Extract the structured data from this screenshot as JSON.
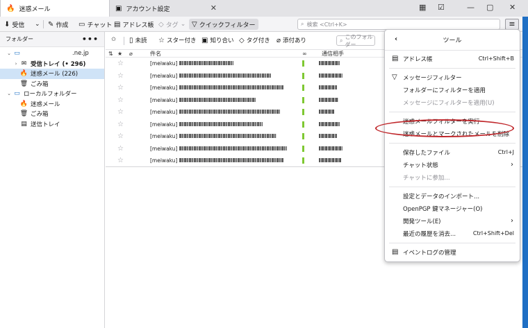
{
  "tabs": [
    {
      "label": "迷惑メール"
    },
    {
      "label": "アカウント設定"
    }
  ],
  "toolbar": {
    "get_messages": "受信",
    "compose": "作成",
    "chat": "チャット",
    "address_book": "アドレス帳",
    "tag": "タグ",
    "quick_filter": "クイックフィルター",
    "search_placeholder": "検索 <Ctrl+K>"
  },
  "folder_pane": {
    "header": "フォルダー",
    "account": ".ne.jp",
    "folders": [
      {
        "label": "受信トレイ (• 296)",
        "icon": "envelope-icon"
      },
      {
        "label": "迷惑メール (226)",
        "icon": "junk-icon",
        "selected": true
      },
      {
        "label": "ごみ箱",
        "icon": "trash-icon"
      }
    ],
    "local_label": "ローカルフォルダー",
    "local_folders": [
      {
        "label": "迷惑メール",
        "icon": "junk-icon"
      },
      {
        "label": "ごみ箱",
        "icon": "trash-icon"
      },
      {
        "label": "送信トレイ",
        "icon": "outbox-icon"
      }
    ]
  },
  "quick_filter_bar": {
    "unread": "未読",
    "starred": "スター付き",
    "contacts": "知り合い",
    "tagged": "タグ付き",
    "attachments": "添付あり",
    "filter_placeholder": "このフォルダー"
  },
  "columns": {
    "subject": "件名",
    "correspondent": "通信相手"
  },
  "messages": [
    {
      "sender": "[meiwaku]"
    },
    {
      "sender": "[meiwaku]"
    },
    {
      "sender": "[meiwaku]"
    },
    {
      "sender": "[meiwaku]"
    },
    {
      "sender": "[meiwaku]"
    },
    {
      "sender": "[meiwaku]"
    },
    {
      "sender": "[meiwaku]"
    },
    {
      "sender": "[meiwaku]"
    },
    {
      "sender": "[meiwaku]"
    }
  ],
  "tools_menu": {
    "title": "ツール",
    "items": {
      "address_book": {
        "label": "アドレス帳",
        "shortcut": "Ctrl+Shift+B"
      },
      "message_filters": {
        "label": "メッセージフィルター"
      },
      "apply_folder_filter": {
        "label": "フォルダーにフィルターを適用"
      },
      "apply_message_filter": {
        "label": "メッセージにフィルターを適用(U)"
      },
      "run_junk_filter": {
        "label": "迷惑メールフィルターを実行"
      },
      "delete_junk": {
        "label": "迷惑メールとマークされたメールを削除"
      },
      "saved_files": {
        "label": "保存したファイル",
        "shortcut": "Ctrl+J"
      },
      "chat_status": {
        "label": "チャット状態"
      },
      "join_chat": {
        "label": "チャットに参加..."
      },
      "import_settings": {
        "label": "設定とデータのインポート..."
      },
      "openpgp": {
        "label": "OpenPGP 鍵マネージャー(O)"
      },
      "dev_tools": {
        "label": "開発ツール(E)"
      },
      "clear_history": {
        "label": "最近の履歴を消去...",
        "shortcut": "Ctrl+Shift+Del"
      },
      "event_log": {
        "label": "イベントログの管理"
      }
    }
  }
}
